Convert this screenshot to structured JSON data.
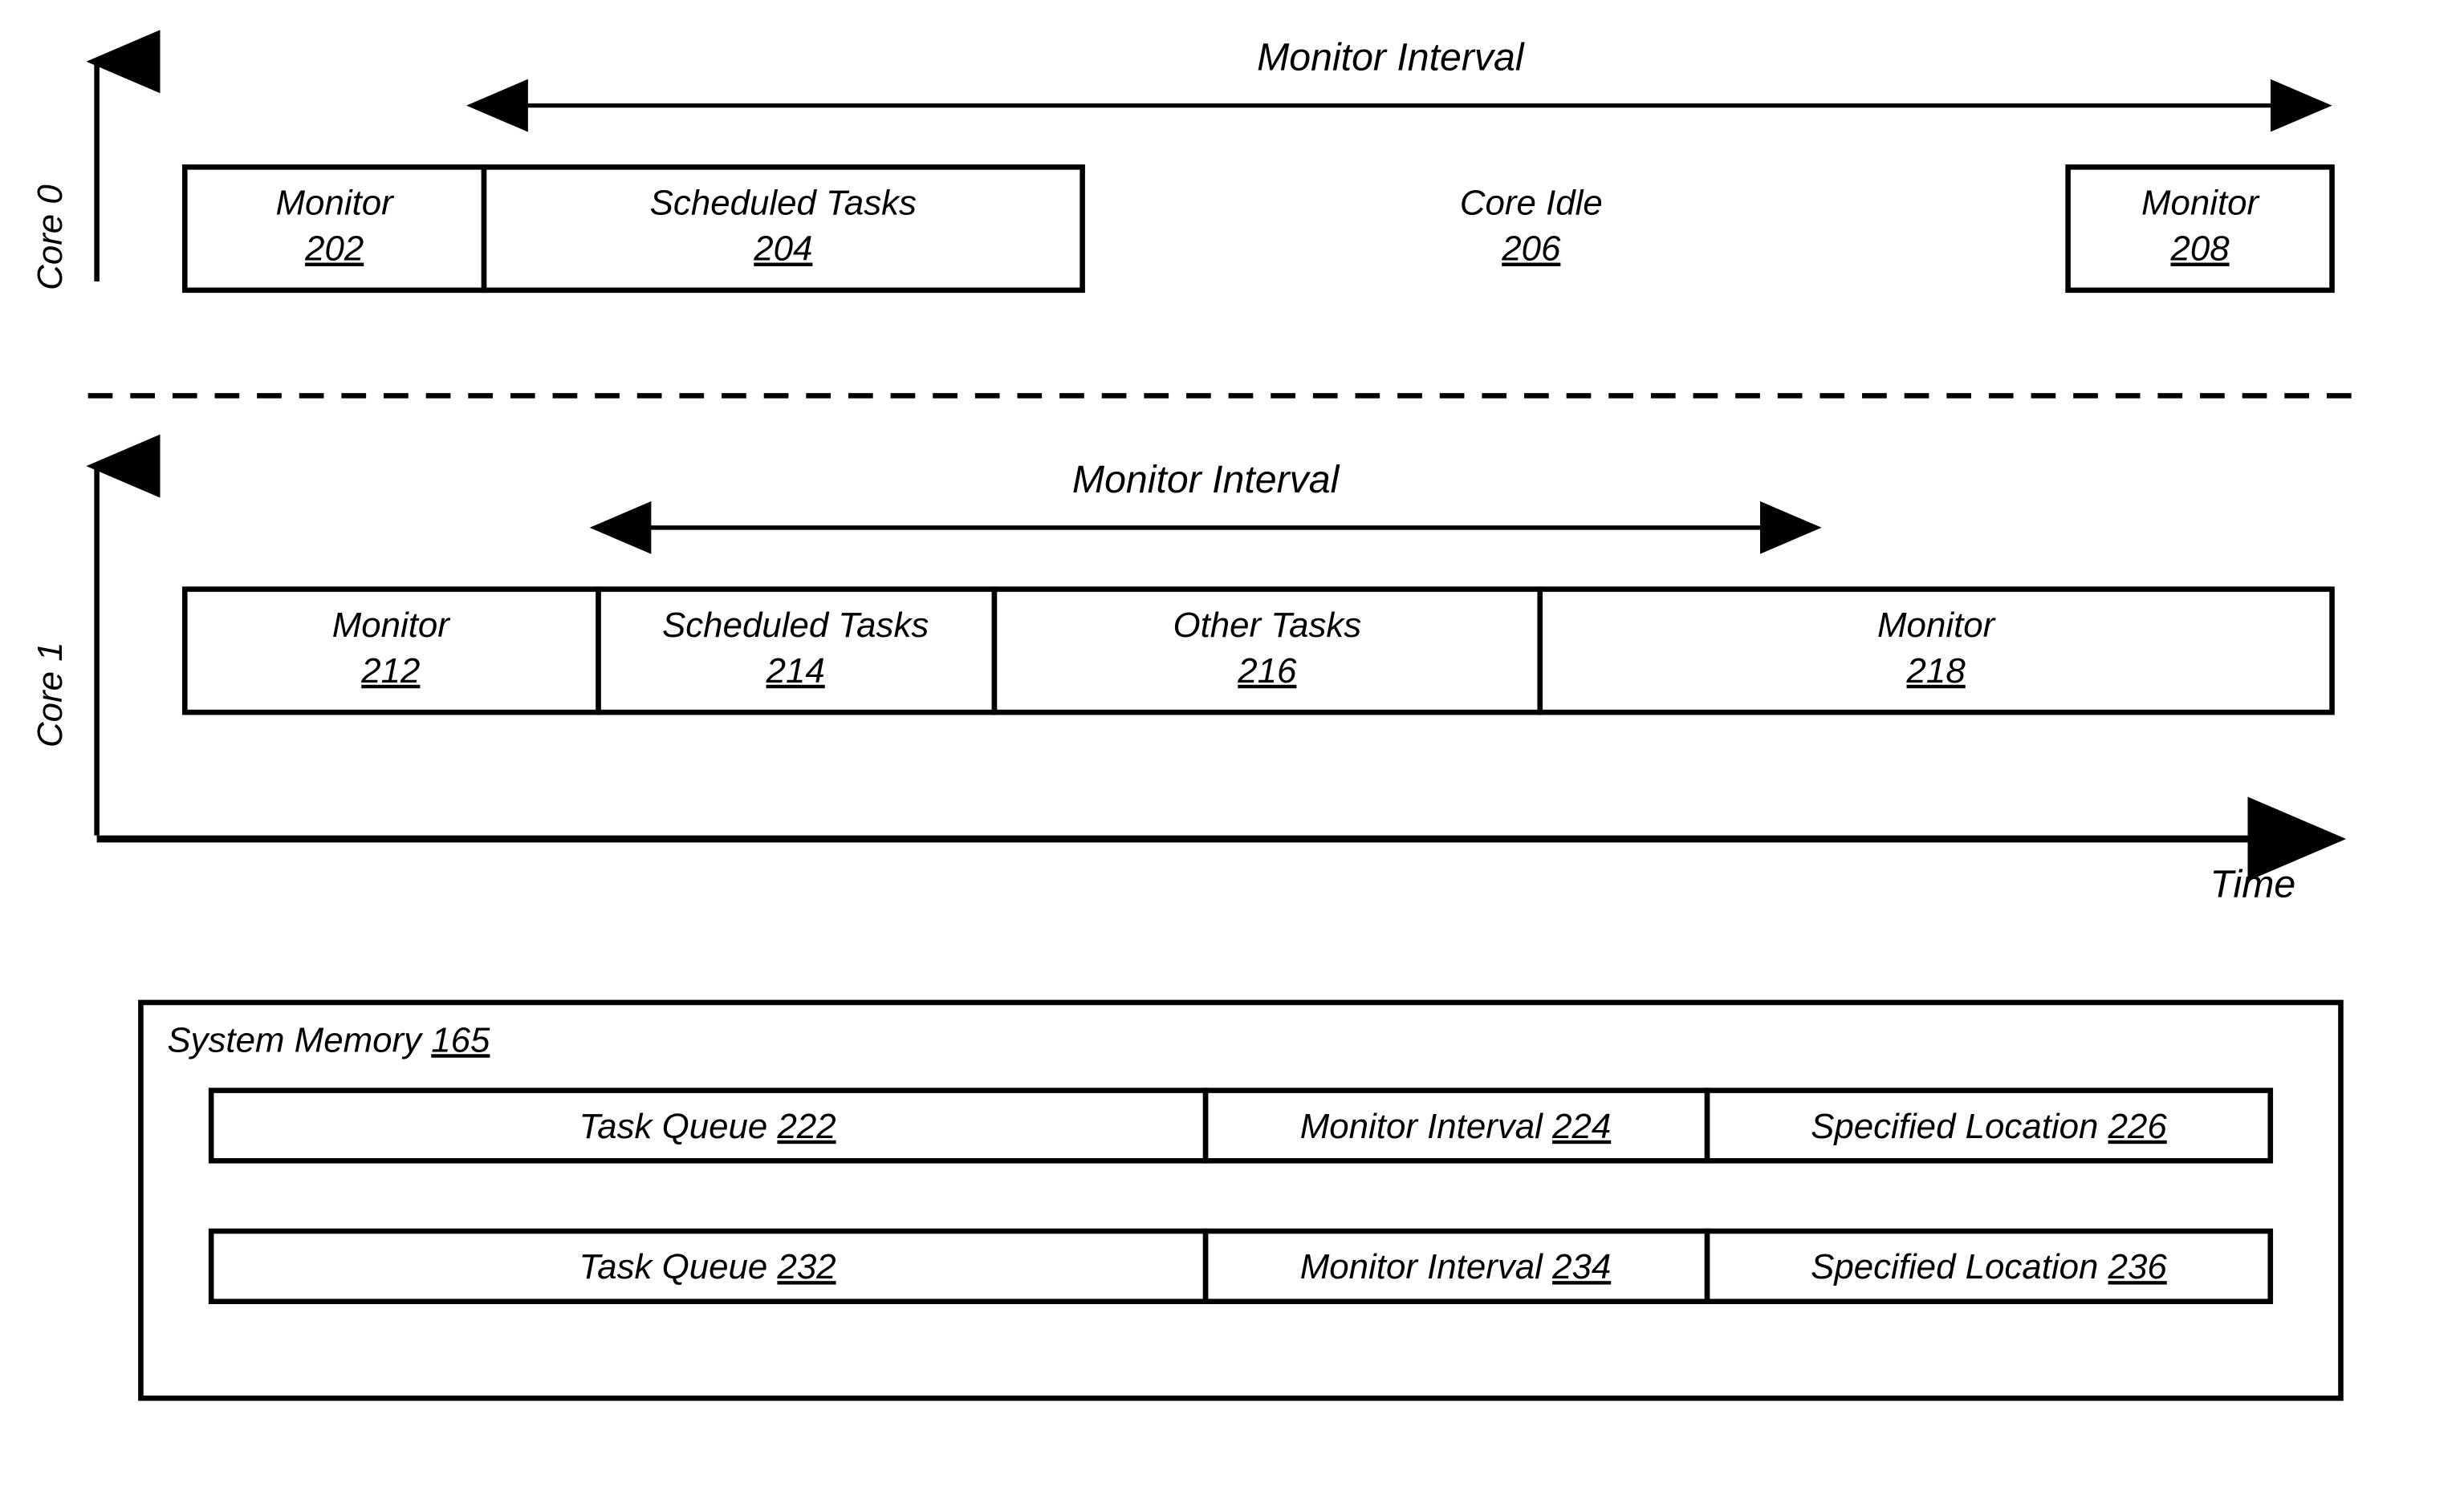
{
  "axes": {
    "core0_label": "Core 0",
    "core1_label": "Core 1",
    "time_label": "Time"
  },
  "intervals": {
    "top_label": "Monitor Interval",
    "bottom_label": "Monitor Interval"
  },
  "core0": {
    "monitor1": {
      "title": "Monitor",
      "ref": "202"
    },
    "scheduled": {
      "title": "Scheduled Tasks",
      "ref": "204"
    },
    "idle": {
      "title": "Core Idle",
      "ref": "206"
    },
    "monitor2": {
      "title": "Monitor",
      "ref": "208"
    }
  },
  "core1": {
    "monitor1": {
      "title": "Monitor",
      "ref": "212"
    },
    "scheduled": {
      "title": "Scheduled Tasks",
      "ref": "214"
    },
    "other": {
      "title": "Other Tasks",
      "ref": "216"
    },
    "monitor2": {
      "title": "Monitor",
      "ref": "218"
    }
  },
  "memory": {
    "title": "System Memory",
    "ref": "165",
    "row1": {
      "tq": {
        "title": "Task Queue",
        "ref": "222"
      },
      "mi": {
        "title": "Monitor Interval",
        "ref": "224"
      },
      "sl": {
        "title": "Specified Location",
        "ref": "226"
      }
    },
    "row2": {
      "tq": {
        "title": "Task Queue",
        "ref": "232"
      },
      "mi": {
        "title": "Monitor Interval",
        "ref": "234"
      },
      "sl": {
        "title": "Specified Location",
        "ref": "236"
      }
    }
  }
}
